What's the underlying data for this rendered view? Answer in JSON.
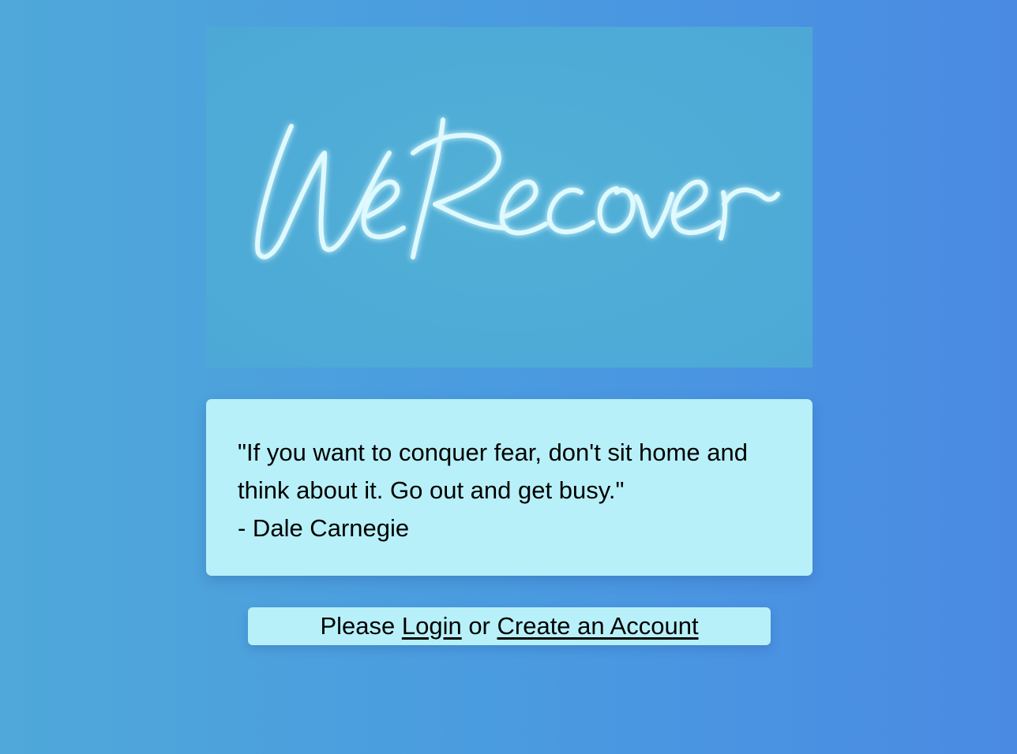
{
  "logo": {
    "wordmark": "WeRecover",
    "colors": {
      "background": "#4eabd6",
      "glow": "#dffaff"
    }
  },
  "quote": {
    "text": "\"If you want to conquer fear, don't sit home and think about it. Go out and get busy.\"",
    "author": "- Dale Carnegie"
  },
  "auth": {
    "prefix": "Please ",
    "login_label": "Login",
    "middle": " or ",
    "create_label": "Create an Account"
  },
  "colors": {
    "card": "#b7f0f8",
    "background_left": "#4fa8d9",
    "background_right": "#4a8ae3"
  }
}
